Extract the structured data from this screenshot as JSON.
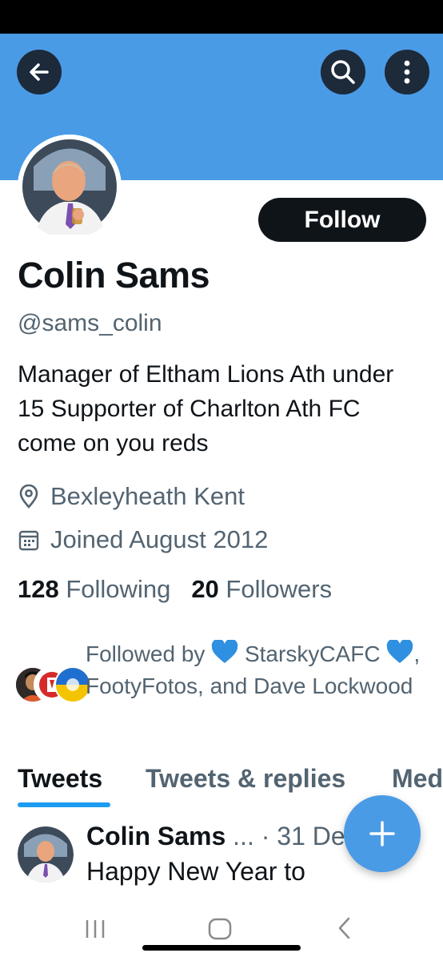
{
  "header": {
    "back_icon": "arrow-left-icon",
    "search_icon": "search-icon",
    "more_icon": "more-vertical-icon",
    "banner_color": "#4a9be6"
  },
  "profile": {
    "name": "Colin Sams",
    "handle": "@sams_colin",
    "follow_label": "Follow",
    "bio": "Manager of Eltham Lions Ath under 15 Supporter of Charlton Ath FC come on you reds",
    "location": "Bexleyheath Kent",
    "joined": "Joined August 2012",
    "following_count": "128",
    "following_label": "Following",
    "followers_count": "20",
    "followers_label": "Followers",
    "followed_by": {
      "prefix": "Followed by",
      "first": "StarskyCAFC",
      "rest": ", FootyFotos, and Dave Lockwood"
    }
  },
  "tabs": [
    {
      "label": "Tweets",
      "active": true
    },
    {
      "label": "Tweets & replies",
      "active": false
    },
    {
      "label": "Media",
      "active": false
    }
  ],
  "tweet": {
    "author": "Colin Sams",
    "meta": "... · 31 De",
    "text": "Happy New Year to"
  },
  "fab": {
    "icon": "plus-icon"
  },
  "colors": {
    "accent": "#1d9bf0",
    "text_primary": "#0f1419",
    "text_secondary": "#536471",
    "fab": "#4a9be6"
  }
}
